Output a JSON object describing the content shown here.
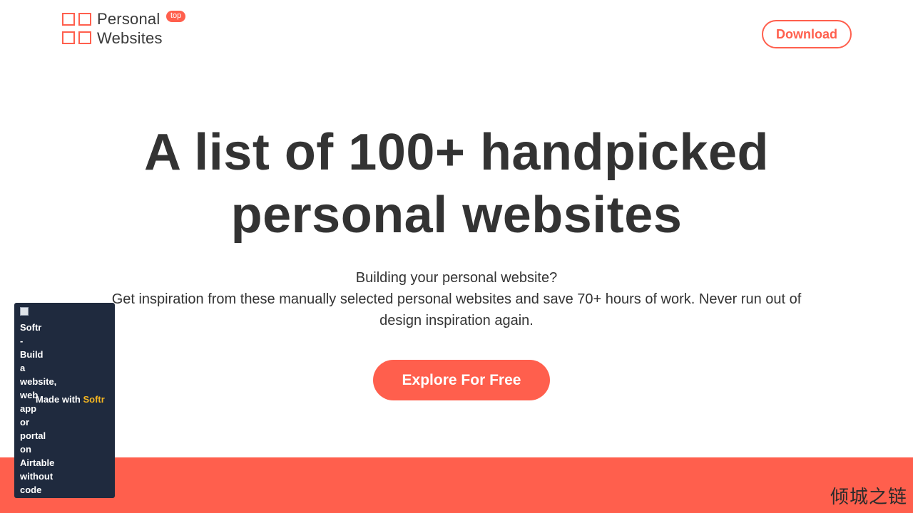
{
  "header": {
    "logo_line1": "Personal",
    "logo_line2": "Websites",
    "logo_badge": "top",
    "download_label": "Download"
  },
  "hero": {
    "title_line1": "A list of 100+ handpicked",
    "title_line2": "personal websites",
    "subtitle_line1": "Building your personal website?",
    "subtitle_line2": "Get inspiration from these manually selected personal websites and save 70+ hours of work. Never run out of",
    "subtitle_line3": "design inspiration again.",
    "cta_label": "Explore For Free"
  },
  "softr_badge": {
    "image_alt": "Softr - Build a website, web app or portal on Airtable without code",
    "made_with": "Made with",
    "brand": "Softr"
  },
  "watermark": "倾城之链",
  "colors": {
    "accent": "#ff5f4d",
    "text": "#333333",
    "badge_bg": "#1f2a3e",
    "brand_yellow": "#f5b621"
  },
  "icons": {
    "logo": "four-squares-grid-icon",
    "broken_image": "broken-image-icon"
  }
}
